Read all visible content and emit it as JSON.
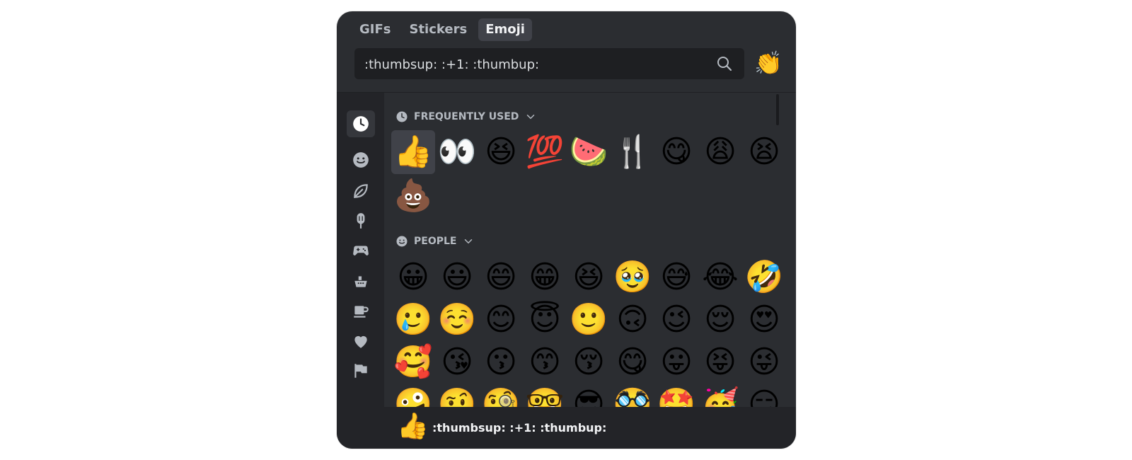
{
  "tabs": [
    {
      "label": "GIFs",
      "active": false
    },
    {
      "label": "Stickers",
      "active": false
    },
    {
      "label": "Emoji",
      "active": true
    }
  ],
  "search": {
    "value": ":thumbsup: :+1: :thumbup:",
    "icon": "search-icon"
  },
  "skin_tone_emoji": "👏",
  "categories": [
    {
      "name": "recent",
      "icon": "clock-icon",
      "active": true
    },
    {
      "name": "people",
      "icon": "smiley-icon"
    },
    {
      "name": "nature",
      "icon": "leaf-icon"
    },
    {
      "name": "food",
      "icon": "popsicle-icon"
    },
    {
      "name": "activities",
      "icon": "gamepad-icon"
    },
    {
      "name": "travel",
      "icon": "ship-icon"
    },
    {
      "name": "objects",
      "icon": "mug-icon"
    },
    {
      "name": "symbols",
      "icon": "heart-icon"
    },
    {
      "name": "flags",
      "icon": "flag-icon"
    }
  ],
  "sections": {
    "frequent": {
      "title": "FREQUENTLY USED",
      "rows": [
        [
          "👍",
          "👀",
          "😆",
          "💯",
          "🍉",
          "🍴",
          "😋",
          "😩",
          "😫"
        ],
        [
          "💩"
        ]
      ]
    },
    "people": {
      "title": "PEOPLE",
      "rows": [
        [
          "😀",
          "😃",
          "😄",
          "😁",
          "😆",
          "🥹",
          "😅",
          "😂",
          "🤣"
        ],
        [
          "🥲",
          "☺️",
          "😊",
          "😇",
          "🙂",
          "🙃",
          "😉",
          "😌",
          "😍"
        ],
        [
          "🥰",
          "😘",
          "😗",
          "😙",
          "😚",
          "😋",
          "😛",
          "😝",
          "😜"
        ],
        [
          "🤪",
          "🤨",
          "🧐",
          "🤓",
          "😎",
          "🥸",
          "🤩",
          "🥳",
          "😏"
        ]
      ]
    }
  },
  "footer": {
    "emoji": "👍",
    "name": ":thumbsup: :+1: :thumbup:"
  },
  "colors": {
    "bg": "#2b2d31",
    "nav": "#232428",
    "selected": "#404249",
    "text": "#b5bac1"
  }
}
